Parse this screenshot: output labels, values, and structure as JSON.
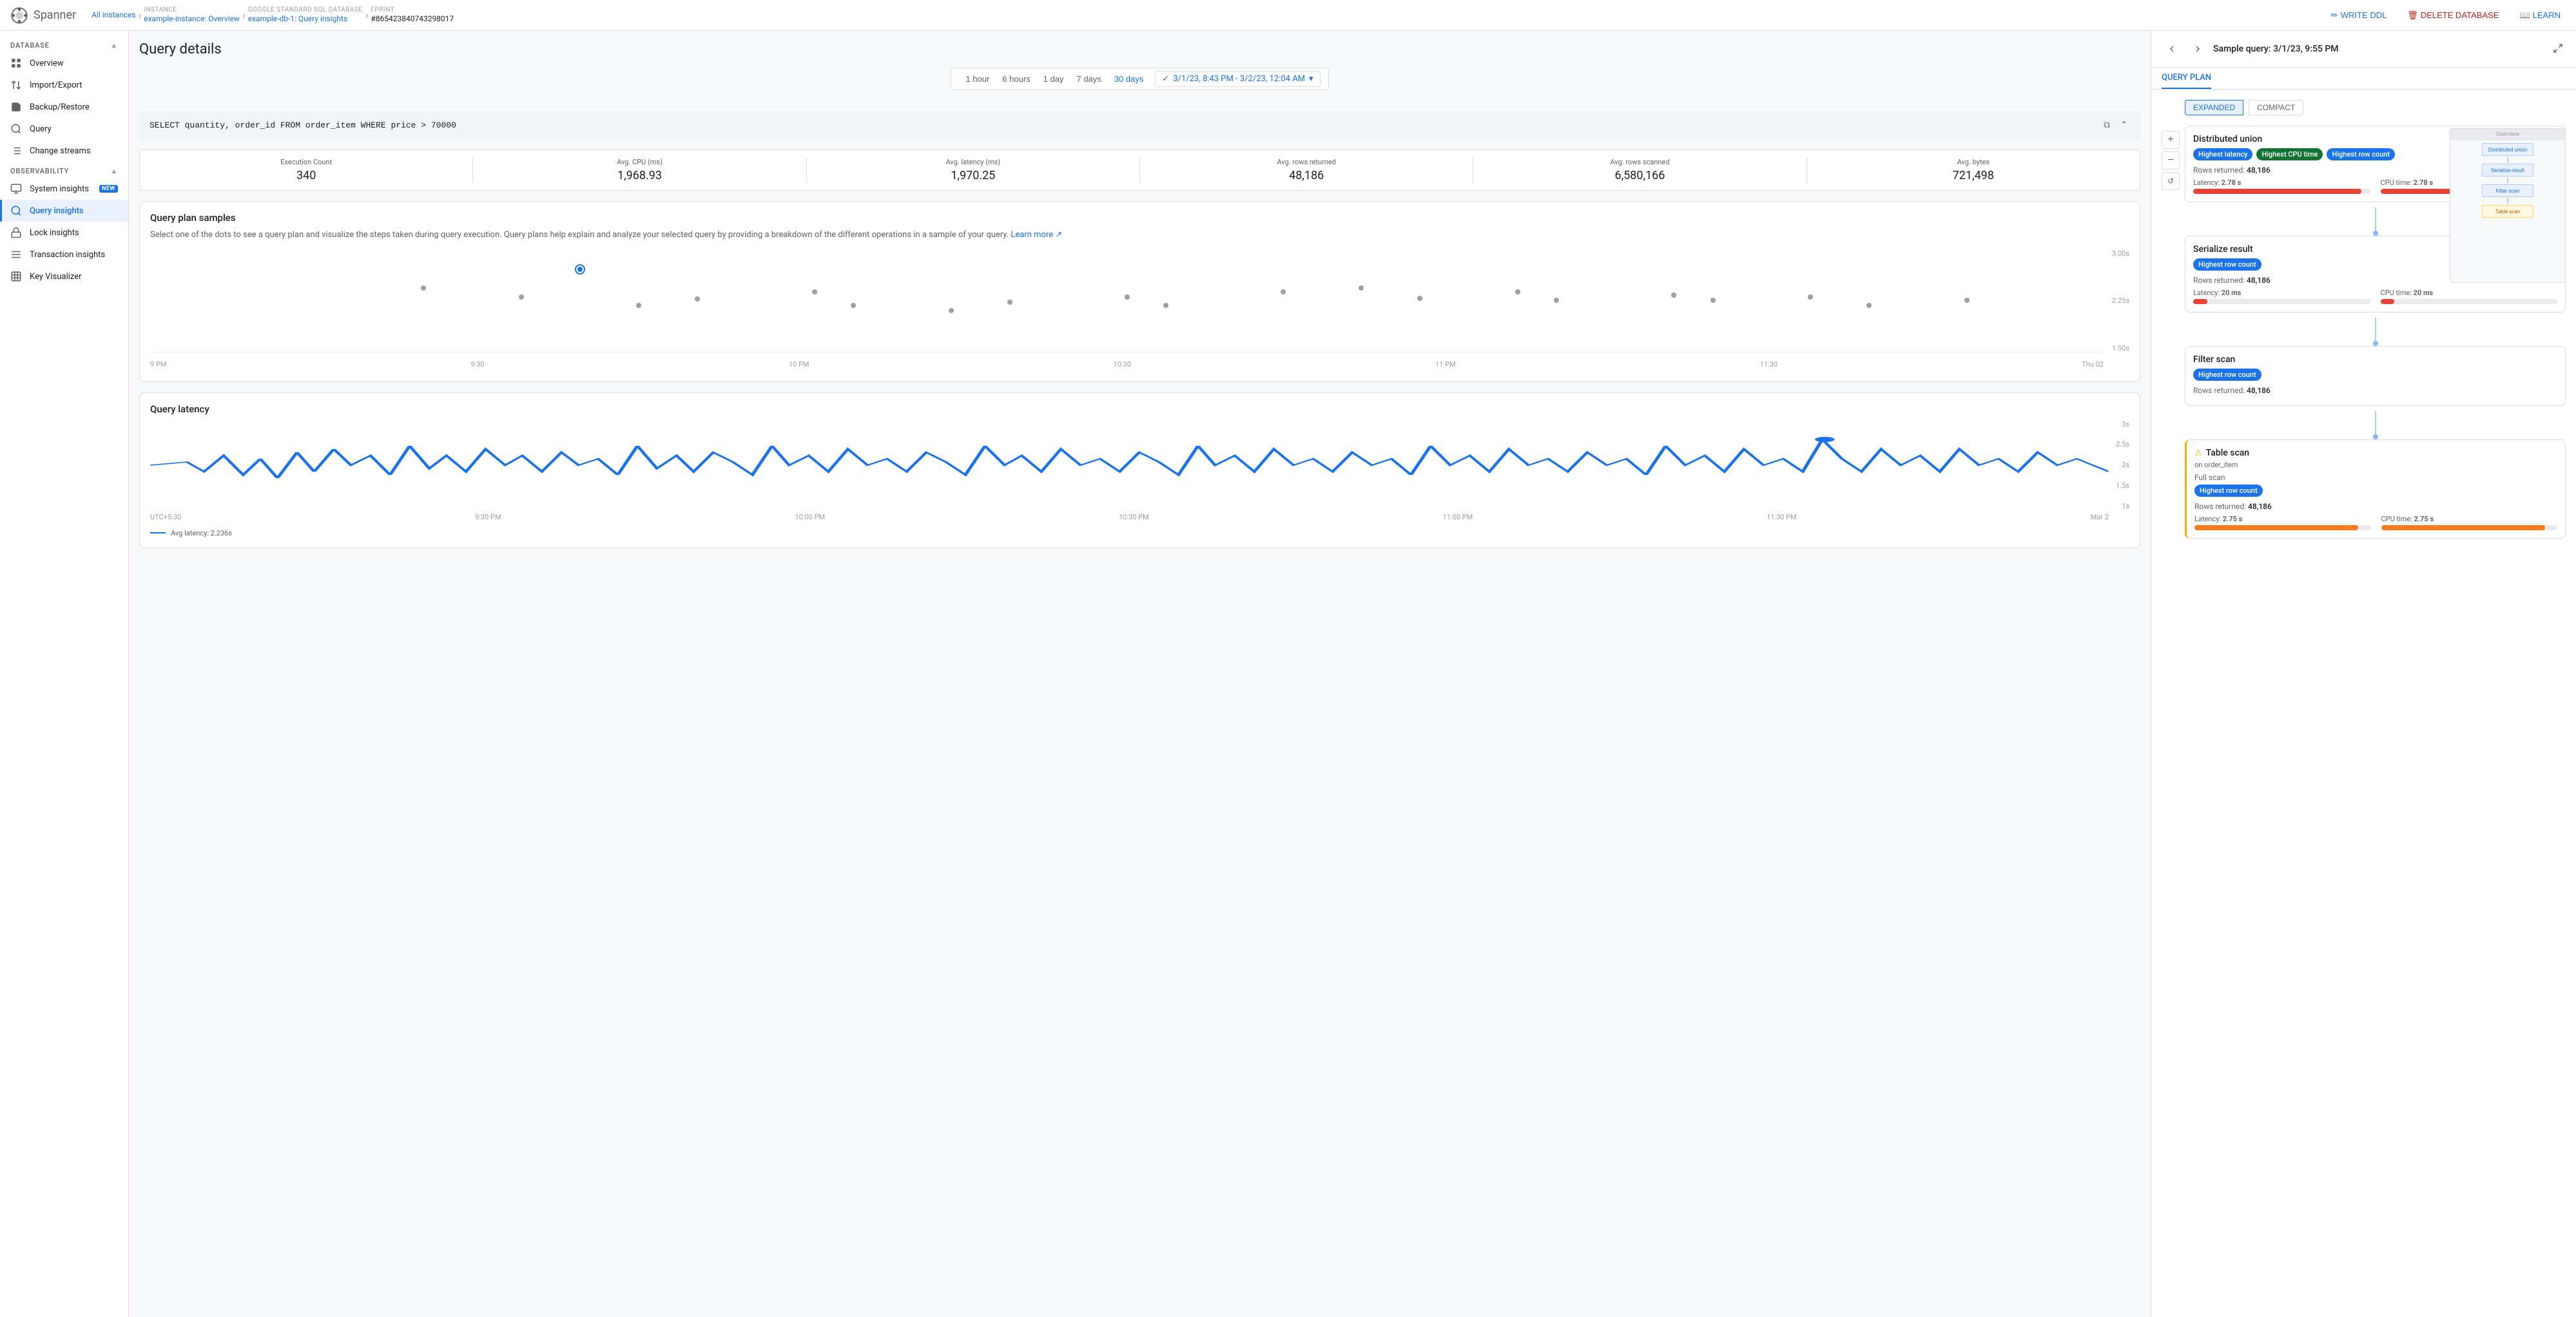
{
  "app": {
    "name": "Spanner"
  },
  "topbar": {
    "breadcrumbs": [
      {
        "label": "All instances",
        "type": "link"
      },
      {
        "section": "INSTANCE",
        "label": "example-instance: Overview",
        "type": "link"
      },
      {
        "section": "GOOGLE STANDARD SQL DATABASE",
        "label": "example-db-1: Query insights",
        "type": "link"
      },
      {
        "section": "FPRINT",
        "label": "#865423840743298017",
        "type": "active"
      }
    ],
    "actions": [
      {
        "label": "WRITE DDL",
        "icon": "pencil"
      },
      {
        "label": "DELETE DATABASE",
        "icon": "trash"
      },
      {
        "label": "LEARN",
        "icon": "book"
      }
    ]
  },
  "sidebar": {
    "database_section": "DATABASE",
    "database_items": [
      {
        "id": "overview",
        "label": "Overview",
        "icon": "grid"
      },
      {
        "id": "import-export",
        "label": "Import/Export",
        "icon": "transfer"
      },
      {
        "id": "backup-restore",
        "label": "Backup/Restore",
        "icon": "save"
      },
      {
        "id": "query",
        "label": "Query",
        "icon": "search"
      },
      {
        "id": "change-streams",
        "label": "Change streams",
        "icon": "list"
      }
    ],
    "observability_section": "OBSERVABILITY",
    "observability_items": [
      {
        "id": "system-insights",
        "label": "System insights",
        "badge": "NEW",
        "icon": "monitor"
      },
      {
        "id": "query-insights",
        "label": "Query insights",
        "icon": "search",
        "active": true
      },
      {
        "id": "lock-insights",
        "label": "Lock insights",
        "icon": "lock"
      },
      {
        "id": "transaction-insights",
        "label": "Transaction insights",
        "icon": "list"
      },
      {
        "id": "key-visualizer",
        "label": "Key Visualizer",
        "icon": "grid"
      }
    ]
  },
  "main": {
    "page_title": "Query details",
    "time_filters": [
      "1 hour",
      "6 hours",
      "1 day",
      "7 days",
      "30 days"
    ],
    "active_time": "30 days",
    "date_range": "3/1/23, 8:43 PM - 3/2/23, 12:04 AM",
    "query_text": "SELECT quantity, order_id FROM order_item WHERE price > 70000",
    "stats": [
      {
        "label": "Execution Count",
        "value": "340"
      },
      {
        "label": "Avg. CPU (ms)",
        "value": "1,968.93"
      },
      {
        "label": "Avg. latency (ms)",
        "value": "1,970.25"
      },
      {
        "label": "Avg. rows returned",
        "value": "48,186"
      },
      {
        "label": "Avg. rows scanned",
        "value": "6,580,166"
      },
      {
        "label": "Avg. bytes",
        "value": "721,498"
      }
    ],
    "query_plan_section": {
      "title": "Query plan samples",
      "description": "Select one of the dots to see a query plan and visualize the steps taken during query execution. Query plans help explain and analyze your selected query by providing a breakdown of the different operations in a sample of your query.",
      "learn_more": "Learn more",
      "scatter_y_labels": [
        "3.00s",
        "2.25s",
        "1.50s"
      ],
      "scatter_x_labels": [
        "9 PM",
        "9:30",
        "10 PM",
        "10:30",
        "11 PM",
        "11:30",
        "Thu 02"
      ]
    },
    "query_latency_section": {
      "title": "Query latency",
      "y_labels": [
        "3s",
        "2.5s",
        "2s",
        "1.5s",
        "1s"
      ],
      "x_labels": [
        "UTC+5:30",
        "9:30 PM",
        "10:00 PM",
        "10:30 PM",
        "11:00 PM",
        "11:30 PM",
        "Mar 2"
      ],
      "legend": "Avg latency: 2.236s"
    }
  },
  "right_panel": {
    "title": "Sample query: 3/1/23, 9:55 PM",
    "tabs": [
      "QUERY PLAN"
    ],
    "active_tab": "QUERY PLAN",
    "view_modes": [
      "EXPANDED",
      "COMPACT"
    ],
    "active_view": "EXPANDED",
    "badges": {
      "highest_latency": "Highest latency",
      "highest_cpu": "Highest CPU time",
      "highest_rowcount": "Highest row count"
    },
    "nodes": [
      {
        "title": "Distributed union",
        "badges": [
          "Highest latency",
          "Highest CPU time",
          "Highest row count"
        ],
        "rows_returned": "48,186",
        "latency": "2.78 s",
        "cpu_time": "2.78 s",
        "latency_bar_pct": 95,
        "cpu_bar_pct": 95,
        "bar_color": "red"
      },
      {
        "title": "Serialize result",
        "badges": [
          "Highest row count"
        ],
        "rows_returned": "48,186",
        "latency": "20 ms",
        "cpu_time": "20 ms",
        "latency_bar_pct": 8,
        "cpu_bar_pct": 8,
        "bar_color": "red"
      },
      {
        "title": "Filter scan",
        "badges": [
          "Highest row count"
        ],
        "rows_returned": "48,186",
        "latency": "",
        "cpu_time": "",
        "latency_bar_pct": 0,
        "cpu_bar_pct": 0,
        "bar_color": "red"
      },
      {
        "title": "Table scan",
        "subtitle": "on order_item",
        "detail": "Full scan",
        "badges": [
          "Highest row count"
        ],
        "rows_returned": "48,186",
        "latency": "2.75 s",
        "cpu_time": "2.75 s",
        "latency_bar_pct": 93,
        "cpu_bar_pct": 93,
        "bar_color": "orange",
        "warning": true
      }
    ]
  }
}
